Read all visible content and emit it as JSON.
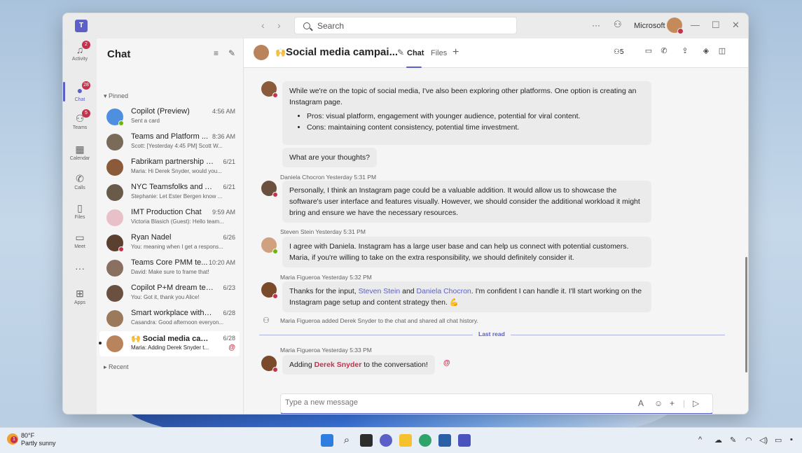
{
  "titlebar": {
    "search_placeholder": "Search",
    "org": "Microsoft",
    "more": "···"
  },
  "rail": [
    {
      "label": "Activity",
      "icon": "bell-icon",
      "glyph": "♫",
      "badge": "2"
    },
    {
      "label": "Chat",
      "icon": "chat-icon",
      "glyph": "●",
      "badge": "28"
    },
    {
      "label": "Teams",
      "icon": "teams-icon",
      "glyph": "⚇",
      "badge": "5"
    },
    {
      "label": "Calendar",
      "icon": "calendar-icon",
      "glyph": "▦",
      "badge": ""
    },
    {
      "label": "Calls",
      "icon": "phone-icon",
      "glyph": "✆",
      "badge": ""
    },
    {
      "label": "Files",
      "icon": "file-icon",
      "glyph": "▯",
      "badge": ""
    },
    {
      "label": "Meet",
      "icon": "video-icon",
      "glyph": "▭",
      "badge": ""
    },
    {
      "label": "",
      "icon": "more-icon",
      "glyph": "···",
      "badge": ""
    },
    {
      "label": "Apps",
      "icon": "apps-icon",
      "glyph": "⊞",
      "badge": ""
    }
  ],
  "chatlist": {
    "title": "Chat",
    "pinned": "▾ Pinned",
    "recent": "▸ Recent",
    "items": [
      {
        "name": "Copilot (Preview)",
        "time": "4:56 AM",
        "preview": "Sent a card",
        "color": "#4f8fe0",
        "status": "#6bb700"
      },
      {
        "name": "Teams and Platform ...",
        "time": "8:36 AM",
        "preview": "Scott: [Yesterday 4:45 PM] Scott W...",
        "color": "#7a6a5a",
        "status": ""
      },
      {
        "name": "Fabrikam partnership co...",
        "time": "6/21",
        "preview": "Maria: Hi Derek Snyder, would you...",
        "color": "#8a5a3a",
        "status": ""
      },
      {
        "name": "NYC Teamsfolks and Alli...",
        "time": "6/21",
        "preview": "Stephanie: Let Ester Bergen know ...",
        "color": "#6a5a4a",
        "status": ""
      },
      {
        "name": "IMT Production Chat",
        "time": "9:59 AM",
        "preview": "Victoria Blasich (Guest): Hello team...",
        "color": "#e8c0c8",
        "status": ""
      },
      {
        "name": "Ryan Nadel",
        "time": "6/26",
        "preview": "You: meaning when I get a respons...",
        "color": "#5a4030",
        "status": "#c4314b"
      },
      {
        "name": "Teams Core PMM te...",
        "time": "10:20 AM",
        "preview": "David: Make sure to frame that!",
        "color": "#8a7060",
        "status": ""
      },
      {
        "name": "Copilot P+M dream team",
        "time": "6/23",
        "preview": "You: Got it, thank you Alice!",
        "color": "#6a5040",
        "status": ""
      },
      {
        "name": "Smart workplace with Te...",
        "time": "6/28",
        "preview": "Casandra: Good afternoon everyon...",
        "color": "#9a7a5a",
        "status": ""
      },
      {
        "name": "Social media camp...",
        "time": "6/28",
        "preview": "Maria: Adding Derek Snyder t...",
        "color": "#b9835c",
        "status": "",
        "emoji": "🙌",
        "mention": "@"
      }
    ]
  },
  "header": {
    "emoji": "🙌",
    "title": "Social media campai...",
    "tab_chat": "Chat",
    "tab_files": "Files",
    "people_count": "5"
  },
  "messages": {
    "m1": {
      "text": "While we're on the topic of social media, I've also been exploring other platforms. One option is creating an Instagram page.",
      "bullet1": "Pros: visual platform, engagement with younger audience, potential for viral content.",
      "bullet2": "Cons: maintaining content consistency, potential time investment.",
      "followup": "What are your thoughts?"
    },
    "m2": {
      "meta": "Daniela Chocron  Yesterday 5:31 PM",
      "text": "Personally, I think an Instagram page could be a valuable addition. It would allow us to showcase the software's user interface and features visually. However, we should consider the additional workload it might bring and ensure we have the necessary resources."
    },
    "m3": {
      "meta": "Steven Stein  Yesterday 5:31 PM",
      "text": "I agree with Daniela. Instagram has a large user base and can help us connect with potential customers. Maria, if you're willing to take on the extra responsibility, we should definitely consider it."
    },
    "m4": {
      "meta": "Maria Figueroa  Yesterday 5:32 PM",
      "pre": "Thanks for the input, ",
      "mention1": "Steven Stein",
      "and": " and ",
      "mention2": "Daniela Chocron",
      "post": ". I'm confident I can handle it. I'll start working on the Instagram page setup and content strategy then. 💪"
    },
    "system": "Maria Figueroa added Derek Snyder to the chat and shared all chat history.",
    "last_read": "Last read",
    "m5": {
      "meta": "Maria Figueroa  Yesterday 5:33 PM",
      "pre": "Adding ",
      "mention": "Derek Snyder",
      "post": " to the conversation!",
      "at": "@"
    }
  },
  "compose": {
    "placeholder": "Type a new message"
  },
  "taskbar": {
    "temp": "80°F",
    "weather": "Partly sunny",
    "weather_badge": "1"
  }
}
